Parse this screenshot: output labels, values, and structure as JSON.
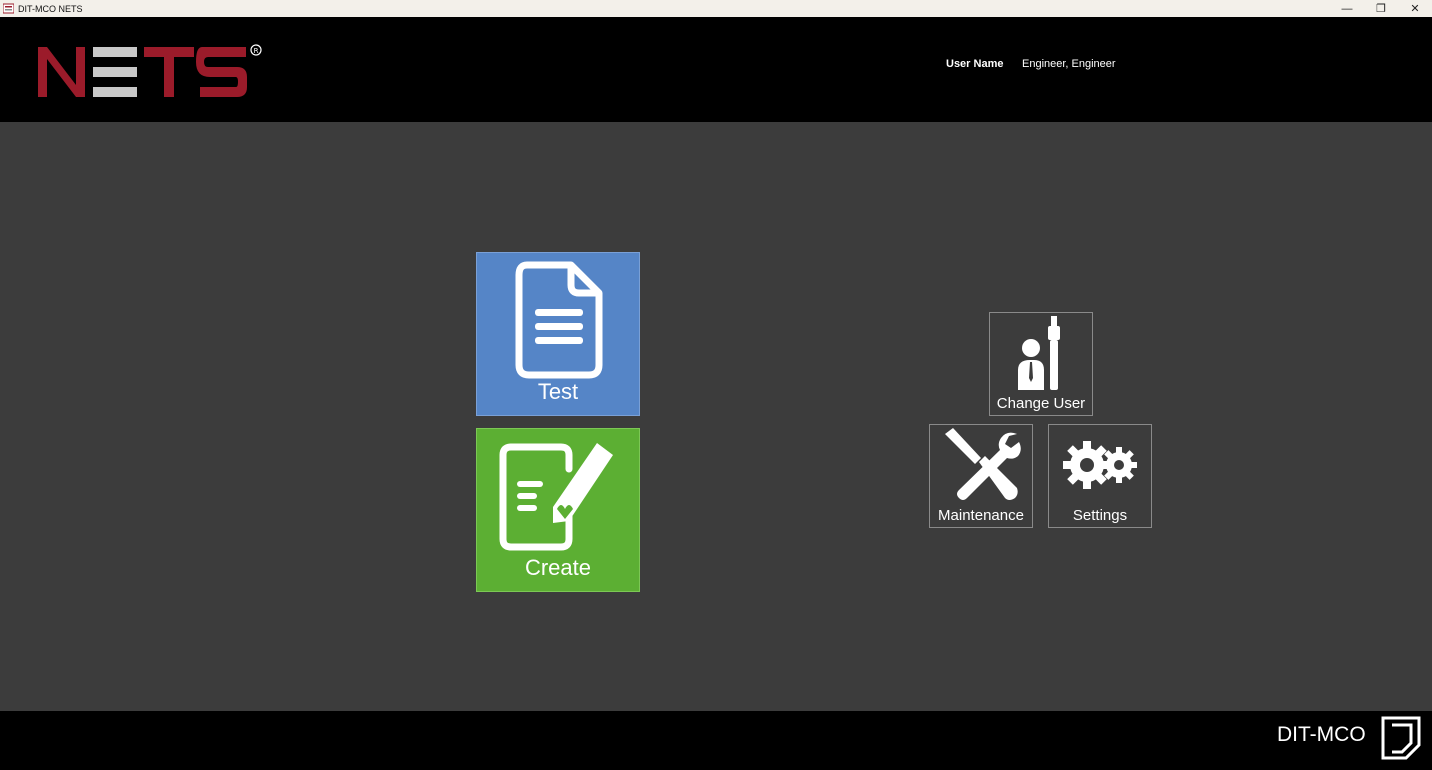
{
  "window": {
    "title": "DIT-MCO NETS",
    "minimize_glyph": "—",
    "restore_glyph": "❐",
    "close_glyph": "✕"
  },
  "header": {
    "logo_text": "NETS",
    "user_label": "User Name",
    "user_value": "Engineer, Engineer"
  },
  "tiles": {
    "test": {
      "label": "Test",
      "icon": "document-icon",
      "color": "#5585c7"
    },
    "create": {
      "label": "Create",
      "icon": "edit-document-icon",
      "color": "#5caf33"
    },
    "change_user": {
      "label": "Change User",
      "icon": "user-wrench-icon"
    },
    "maintenance": {
      "label": "Maintenance",
      "icon": "tools-icon"
    },
    "settings": {
      "label": "Settings",
      "icon": "gears-icon"
    }
  },
  "footer": {
    "brand": "DIT-MCO"
  },
  "colors": {
    "logo_red": "#9b1b2a",
    "logo_gray": "#c8c8c8",
    "background": "#3c3c3c"
  }
}
